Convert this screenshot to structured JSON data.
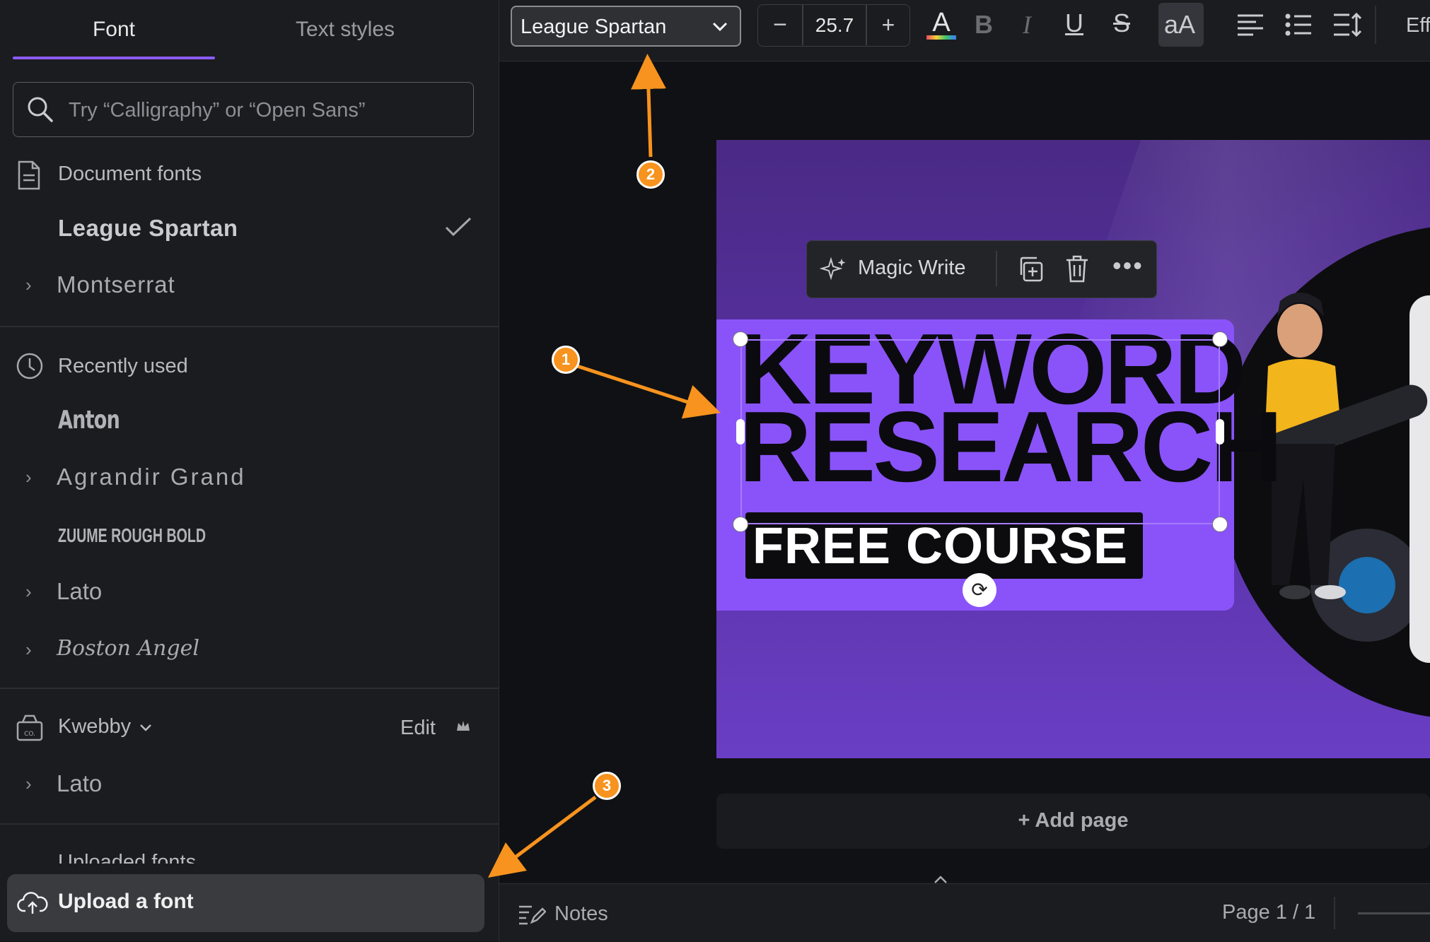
{
  "panel": {
    "tabs": [
      {
        "label": "Font",
        "active": true
      },
      {
        "label": "Text styles",
        "active": false
      }
    ],
    "search": {
      "placeholder": "Try “Calligraphy” or “Open Sans”"
    },
    "document_fonts": {
      "title": "Document fonts",
      "items": [
        {
          "label": "League Spartan",
          "selected": true
        },
        {
          "label": "Montserrat",
          "expandable": true
        }
      ]
    },
    "recently_used": {
      "title": "Recently used",
      "items": [
        {
          "label": "Anton"
        },
        {
          "label": "Agrandir Grand",
          "expandable": true
        },
        {
          "label": "ZUUME ROUGH BOLD"
        },
        {
          "label": "Lato",
          "expandable": true
        },
        {
          "label": "Boston Angel",
          "expandable": true
        }
      ]
    },
    "brand_kit": {
      "title": "Kwebby",
      "edit_label": "Edit",
      "items": [
        {
          "label": "Lato",
          "expandable": true
        }
      ]
    },
    "uploaded_fonts": {
      "title": "Uploaded fonts"
    },
    "upload_button": {
      "label": "Upload a font"
    }
  },
  "toolbar": {
    "font_family": "League Spartan",
    "font_size": "25.7",
    "minus_label": "−",
    "plus_label": "+",
    "effects_label": "Eff",
    "text_color_accent": "#e84a5f"
  },
  "canvas": {
    "title_line1": "KEYWORD",
    "title_line2": "RESEARCH",
    "subtitle": "FREE COURSE",
    "context_menu": {
      "magic_write": "Magic Write"
    },
    "add_page": "+ Add page"
  },
  "bottom_bar": {
    "notes_label": "Notes",
    "page_indicator": "Page 1 / 1"
  },
  "annotations": {
    "badge_1": "1",
    "badge_2": "2",
    "badge_3": "3",
    "arrow_color": "#f7931e"
  }
}
